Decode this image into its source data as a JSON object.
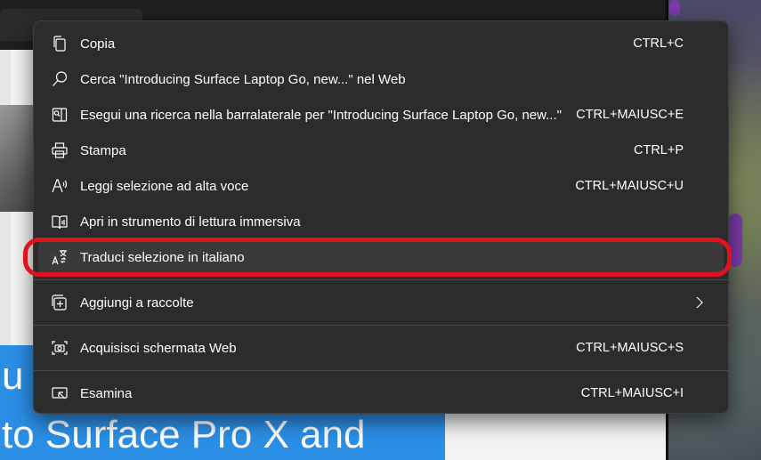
{
  "background": {
    "hero_line1": "u",
    "hero_line2": "to Surface Pro X and"
  },
  "menu": {
    "items": [
      {
        "label": "Copia",
        "shortcut": "CTRL+C"
      },
      {
        "label": "Cerca \"Introducing Surface Laptop Go, new...\" nel Web",
        "shortcut": ""
      },
      {
        "label": "Esegui una ricerca nella barralaterale per \"Introducing Surface Laptop Go, new...\"",
        "shortcut": "CTRL+MAIUSC+E"
      },
      {
        "label": "Stampa",
        "shortcut": "CTRL+P"
      },
      {
        "label": "Leggi selezione ad alta voce",
        "shortcut": "CTRL+MAIUSC+U"
      },
      {
        "label": "Apri in strumento di lettura immersiva",
        "shortcut": ""
      },
      {
        "label": "Traduci selezione in italiano",
        "shortcut": ""
      },
      {
        "label": "Aggiungi a raccolte",
        "shortcut": ""
      },
      {
        "label": "Acquisisci schermata Web",
        "shortcut": "CTRL+MAIUSC+S"
      },
      {
        "label": "Esamina",
        "shortcut": "CTRL+MAIUSC+I"
      }
    ]
  },
  "colors": {
    "menu_bg": "#2c2c2c",
    "highlight_ring": "#e0121e",
    "hero_blue": "#2b8fe6"
  }
}
